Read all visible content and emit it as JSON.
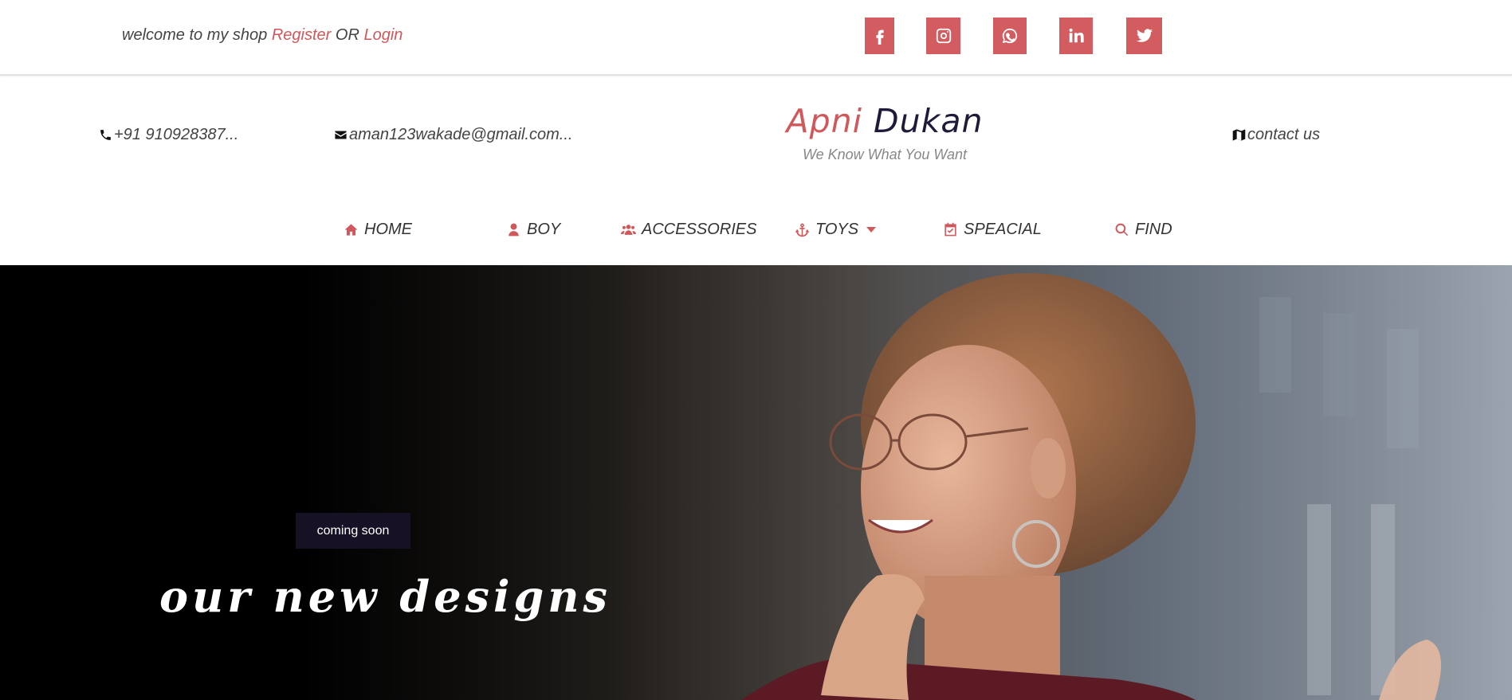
{
  "topbar": {
    "welcome_text": "welcome to my shop",
    "register_label": "Register",
    "or_text": "OR",
    "login_label": "Login",
    "social": [
      {
        "icon": "facebook-icon"
      },
      {
        "icon": "instagram-icon"
      },
      {
        "icon": "whatsapp-icon"
      },
      {
        "icon": "linkedin-icon"
      },
      {
        "icon": "twitter-icon"
      }
    ]
  },
  "info": {
    "phone": "+91 910928387...",
    "email": "aman123wakade@gmail.com...",
    "contact": "contact us"
  },
  "brand": {
    "word1": "Apni",
    "word2": "Dukan",
    "tagline": "We Know What You Want"
  },
  "nav": {
    "home": "HOME",
    "boy": "BOY",
    "accessories": "ACCESSORIES",
    "toys": "TOYS",
    "special": "SPEACIAL",
    "find": "FIND"
  },
  "hero": {
    "badge": "coming soon",
    "title": "our new designs"
  },
  "colors": {
    "accent": "#d0575a",
    "brand_dark": "#1e1b3a",
    "badge_bg": "#161124"
  }
}
